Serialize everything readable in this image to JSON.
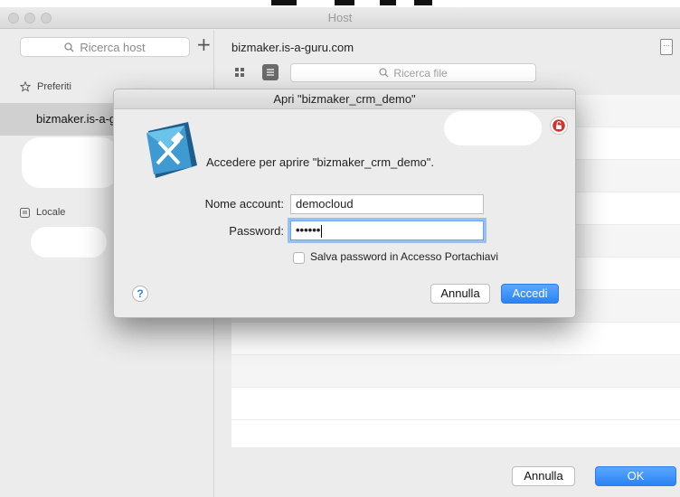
{
  "window": {
    "title": "Host"
  },
  "sidebar": {
    "search_placeholder": "Ricerca host",
    "add_symbol": "+",
    "favorites_label": "Preferiti",
    "selected_host": "bizmaker.is-a-g",
    "local_label": "Locale"
  },
  "main": {
    "host_title": "bizmaker.is-a-guru.com",
    "search_file_placeholder": "Ricerca file",
    "cancel_label": "Annulla",
    "ok_label": "OK"
  },
  "dialog": {
    "title": "Apri \"bizmaker_crm_demo\"",
    "message": "Accedere per aprire \"bizmaker_crm_demo\".",
    "account_label": "Nome account:",
    "account_value": "democloud",
    "password_label": "Password:",
    "password_value": "••••••",
    "save_password_label": "Salva password in Accesso Portachiavi",
    "help_symbol": "?",
    "cancel_label": "Annulla",
    "login_label": "Accedi"
  },
  "colors": {
    "accent": "#2a83f4",
    "lock": "#d9302b"
  }
}
